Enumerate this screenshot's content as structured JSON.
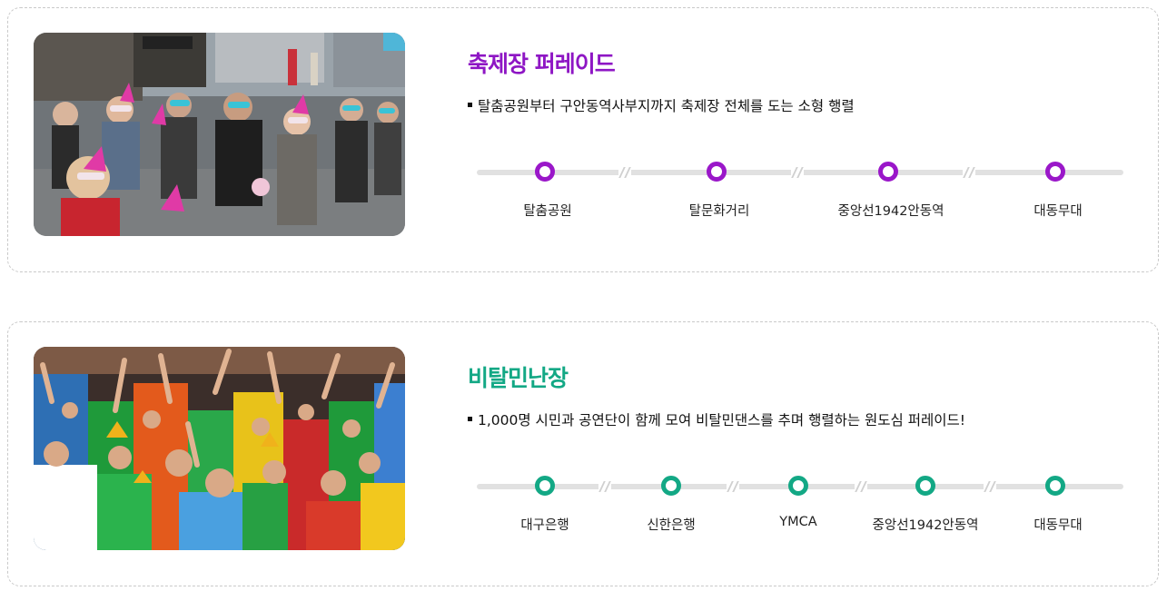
{
  "sections": [
    {
      "title": "축제장 퍼레이드",
      "description": "탈춤공원부터 구안동역사부지까지 축제장 전체를 도는 소형 행렬",
      "accent": "#9a17c9",
      "photo_subject": "masked-parade-crowd-photo",
      "stops": [
        "탈춤공원",
        "탈문화거리",
        "중앙선1942안동역",
        "대동무대"
      ]
    },
    {
      "title": "비탈민난장",
      "description": "1,000명 시민과 공연단이 함께 모여 비탈민댄스를 추며 행렬하는 원도심 퍼레이드!",
      "accent": "#13a885",
      "photo_subject": "colorful-dance-crowd-photo",
      "stops": [
        "대구은행",
        "신한은행",
        "YMCA",
        "중앙선1942안동역",
        "대동무대"
      ]
    }
  ]
}
